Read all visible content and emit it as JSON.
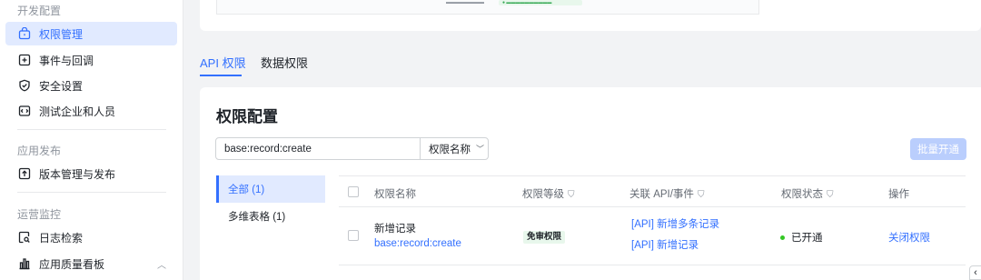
{
  "sidebar": {
    "dev_section": "开发配置",
    "items": [
      {
        "label": "权限管理",
        "icon": "lock-box-icon"
      },
      {
        "label": "事件与回调",
        "icon": "plus-box-icon"
      },
      {
        "label": "安全设置",
        "icon": "shield-check-icon"
      },
      {
        "label": "测试企业和人员",
        "icon": "code-box-icon"
      }
    ],
    "release_section": "应用发布",
    "release_item": {
      "label": "版本管理与发布",
      "icon": "upload-box-icon"
    },
    "ops_section": "运营监控",
    "ops_items": [
      {
        "label": "日志检索",
        "icon": "log-search-icon"
      },
      {
        "label": "应用质量看板",
        "icon": "bar-chart-icon"
      }
    ]
  },
  "tabs": [
    {
      "label": "API 权限"
    },
    {
      "label": "数据权限"
    }
  ],
  "card": {
    "title": "权限配置",
    "search_value": "base:record:create",
    "search_field": "权限名称",
    "batch_button": "批量开通"
  },
  "categories": [
    {
      "label": "全部 (1)"
    },
    {
      "label": "多维表格 (1)"
    }
  ],
  "table": {
    "headers": {
      "name": "权限名称",
      "level": "权限等级",
      "api": "关联 API/事件",
      "status": "权限状态",
      "action": "操作"
    },
    "rows": [
      {
        "name": "新增记录",
        "scope": "base:record:create",
        "level": "免审权限",
        "apis": [
          "[API] 新增多条记录",
          "[API] 新增记录"
        ],
        "status": "已开通",
        "action": "关闭权限"
      }
    ]
  },
  "colors": {
    "accent": "#3370ff",
    "active_bg": "#e1eaff",
    "status_green": "#34c724",
    "badge_bg": "#e8f7ec"
  }
}
